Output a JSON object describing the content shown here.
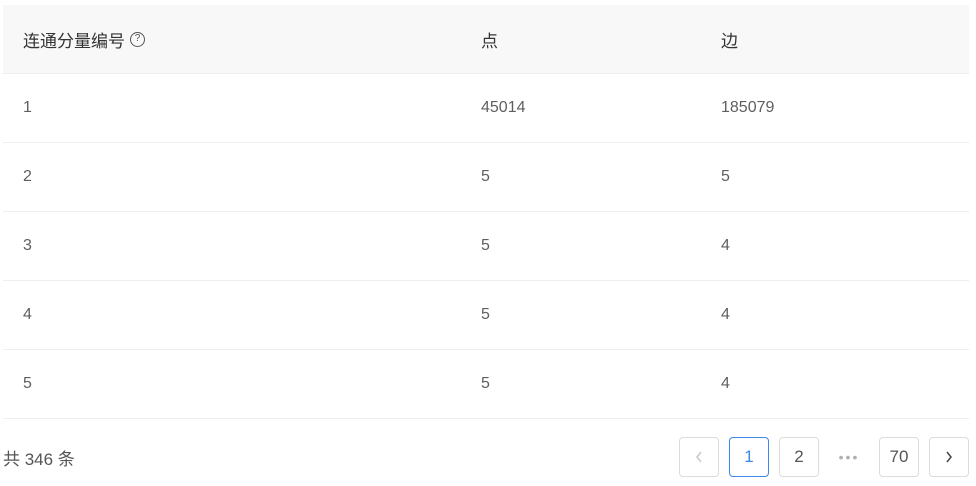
{
  "table": {
    "headers": {
      "component_id": "连通分量编号",
      "component_help_icon": "question-circle-icon",
      "nodes": "点",
      "edges": "边"
    },
    "rows": [
      {
        "id": "1",
        "nodes": "45014",
        "edges": "185079"
      },
      {
        "id": "2",
        "nodes": "5",
        "edges": "5"
      },
      {
        "id": "3",
        "nodes": "5",
        "edges": "4"
      },
      {
        "id": "4",
        "nodes": "5",
        "edges": "4"
      },
      {
        "id": "5",
        "nodes": "5",
        "edges": "4"
      }
    ]
  },
  "pagination": {
    "total_text": "共 346 条",
    "prev_icon": "chevron-left-icon",
    "next_icon": "chevron-right-icon",
    "pages": [
      "1",
      "2"
    ],
    "current_page": "1",
    "ellipsis": "•••",
    "last_page": "70"
  },
  "colors": {
    "accent": "#3c89e8",
    "header_bg": "#f8f8f8",
    "divider": "#eeeeee"
  }
}
